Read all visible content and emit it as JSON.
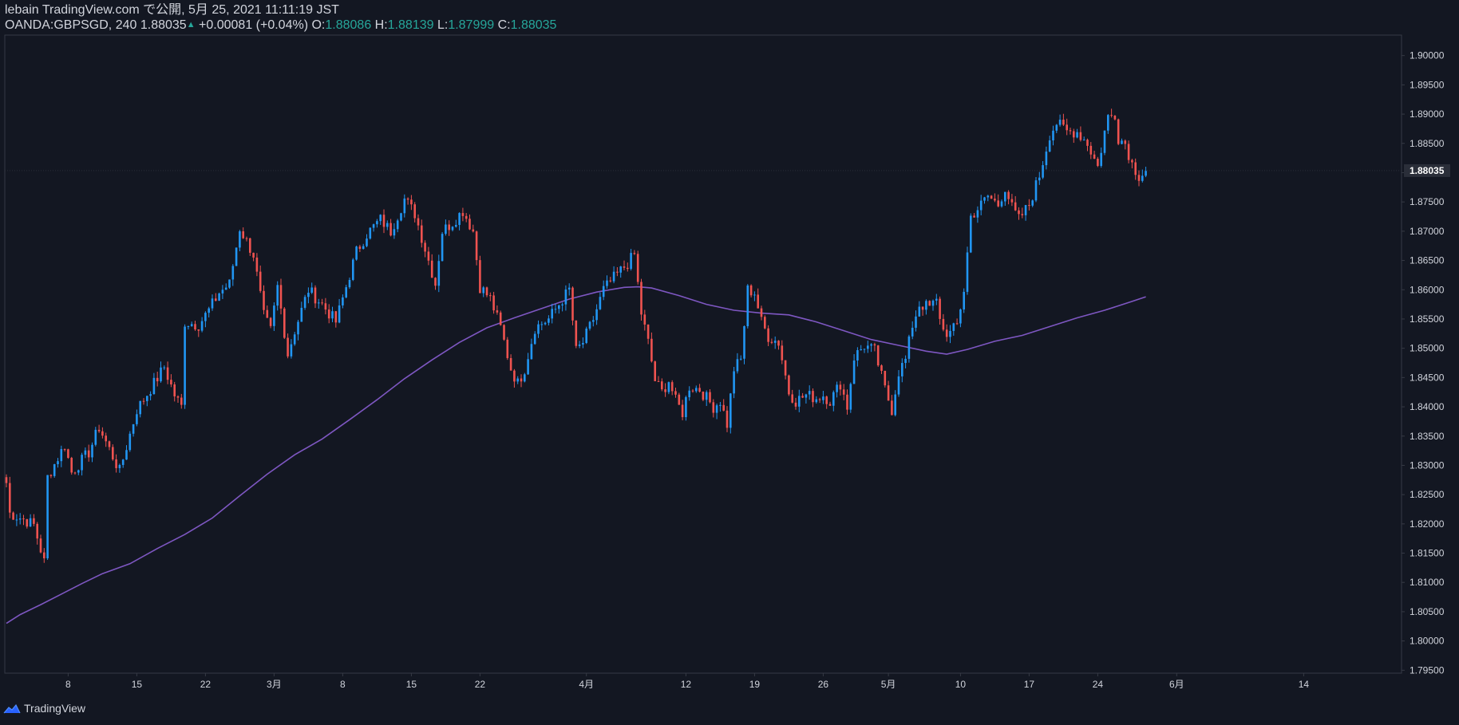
{
  "header": {
    "title_line": "lebain TradingView.com で公開, 5月 25, 2021 11:11:19 JST",
    "symbol": "OANDA:GBPSGD, 240",
    "last": "1.88035",
    "change": "+0.00081 (+0.04%)",
    "o_label": "O:",
    "o_value": "1.88086",
    "h_label": "H:",
    "h_value": "1.88139",
    "l_label": "L:",
    "l_value": "1.87999",
    "c_label": "C:",
    "c_value": "1.88035"
  },
  "footer": {
    "brand": "TradingView",
    "logo_icon": "tradingview-logo-icon"
  },
  "colors": {
    "background": "#131722",
    "up": "#2196f3",
    "down": "#ef5350",
    "ma": "#7e57c2",
    "text": "#d1d4dc",
    "value_green": "#26a69a",
    "axis": "#363a45"
  },
  "chart_data": {
    "type": "candlestick",
    "symbol": "OANDA:GBPSGD",
    "interval": "240",
    "ylim": [
      1.7945,
      1.9035
    ],
    "y_ticks": [
      "1.90000",
      "1.89500",
      "1.89000",
      "1.88500",
      "1.88000",
      "1.87500",
      "1.87000",
      "1.86500",
      "1.86000",
      "1.85500",
      "1.85000",
      "1.84500",
      "1.84000",
      "1.83500",
      "1.83000",
      "1.82500",
      "1.82000",
      "1.81500",
      "1.81000",
      "1.80500",
      "1.80000",
      "1.79500"
    ],
    "last_price_label": "1.88035",
    "x_ticks": [
      {
        "label": "8",
        "index": 18
      },
      {
        "label": "15",
        "index": 38
      },
      {
        "label": "22",
        "index": 58
      },
      {
        "label": "3月",
        "index": 78
      },
      {
        "label": "8",
        "index": 98
      },
      {
        "label": "15",
        "index": 118
      },
      {
        "label": "22",
        "index": 138
      },
      {
        "label": "4月",
        "index": 169
      },
      {
        "label": "12",
        "index": 198
      },
      {
        "label": "19",
        "index": 218
      },
      {
        "label": "26",
        "index": 238
      },
      {
        "label": "5月",
        "index": 257
      },
      {
        "label": "10",
        "index": 278
      },
      {
        "label": "17",
        "index": 298
      },
      {
        "label": "24",
        "index": 318
      },
      {
        "label": "6月",
        "index": 341
      },
      {
        "label": "14",
        "index": 378
      }
    ],
    "anchors": [
      [
        0,
        1.827
      ],
      [
        1,
        1.8218
      ],
      [
        5,
        1.8208
      ],
      [
        8,
        1.8198
      ],
      [
        11,
        1.8135
      ],
      [
        12,
        1.828
      ],
      [
        17,
        1.8335
      ],
      [
        19,
        1.8288
      ],
      [
        24,
        1.8322
      ],
      [
        27,
        1.8365
      ],
      [
        33,
        1.829
      ],
      [
        38,
        1.8395
      ],
      [
        43,
        1.844
      ],
      [
        46,
        1.8468
      ],
      [
        49,
        1.842
      ],
      [
        51,
        1.84
      ],
      [
        52,
        1.8545
      ],
      [
        56,
        1.854
      ],
      [
        59,
        1.8565
      ],
      [
        62,
        1.8595
      ],
      [
        65,
        1.861
      ],
      [
        68,
        1.8705
      ],
      [
        72,
        1.866
      ],
      [
        75,
        1.8555
      ],
      [
        77,
        1.853
      ],
      [
        79,
        1.8605
      ],
      [
        82,
        1.849
      ],
      [
        84,
        1.853
      ],
      [
        88,
        1.86
      ],
      [
        92,
        1.8575
      ],
      [
        96,
        1.8545
      ],
      [
        99,
        1.8605
      ],
      [
        102,
        1.8665
      ],
      [
        105,
        1.8695
      ],
      [
        109,
        1.872
      ],
      [
        112,
        1.87
      ],
      [
        116,
        1.8755
      ],
      [
        119,
        1.873
      ],
      [
        123,
        1.865
      ],
      [
        125,
        1.861
      ],
      [
        127,
        1.87
      ],
      [
        130,
        1.8715
      ],
      [
        133,
        1.8735
      ],
      [
        136,
        1.87
      ],
      [
        138,
        1.8605
      ],
      [
        141,
        1.8585
      ],
      [
        144,
        1.8535
      ],
      [
        147,
        1.8465
      ],
      [
        149,
        1.844
      ],
      [
        151,
        1.8465
      ],
      [
        154,
        1.8535
      ],
      [
        158,
        1.855
      ],
      [
        161,
        1.8575
      ],
      [
        164,
        1.86
      ],
      [
        166,
        1.8495
      ],
      [
        168,
        1.851
      ],
      [
        171,
        1.855
      ],
      [
        174,
        1.86
      ],
      [
        177,
        1.862
      ],
      [
        181,
        1.8645
      ],
      [
        183,
        1.866
      ],
      [
        185,
        1.856
      ],
      [
        187,
        1.851
      ],
      [
        189,
        1.8445
      ],
      [
        191,
        1.8425
      ],
      [
        193,
        1.8445
      ],
      [
        195,
        1.841
      ],
      [
        197,
        1.839
      ],
      [
        199,
        1.8435
      ],
      [
        202,
        1.843
      ],
      [
        204,
        1.8415
      ],
      [
        206,
        1.84
      ],
      [
        208,
        1.841
      ],
      [
        210,
        1.837
      ],
      [
        212,
        1.8465
      ],
      [
        214,
        1.848
      ],
      [
        216,
        1.86
      ],
      [
        218,
        1.8595
      ],
      [
        220,
        1.8545
      ],
      [
        222,
        1.852
      ],
      [
        225,
        1.851
      ],
      [
        228,
        1.8425
      ],
      [
        230,
        1.841
      ],
      [
        233,
        1.842
      ],
      [
        236,
        1.8415
      ],
      [
        238,
        1.842
      ],
      [
        240,
        1.841
      ],
      [
        243,
        1.844
      ],
      [
        245,
        1.84
      ],
      [
        247,
        1.8485
      ],
      [
        250,
        1.8505
      ],
      [
        253,
        1.8495
      ],
      [
        256,
        1.843
      ],
      [
        258,
        1.8395
      ],
      [
        260,
        1.846
      ],
      [
        262,
        1.848
      ],
      [
        264,
        1.854
      ],
      [
        266,
        1.8575
      ],
      [
        269,
        1.857
      ],
      [
        271,
        1.858
      ],
      [
        273,
        1.853
      ],
      [
        275,
        1.8525
      ],
      [
        277,
        1.854
      ],
      [
        279,
        1.86
      ],
      [
        281,
        1.8725
      ],
      [
        284,
        1.8745
      ],
      [
        286,
        1.876
      ],
      [
        289,
        1.8745
      ],
      [
        291,
        1.8775
      ],
      [
        293,
        1.874
      ],
      [
        295,
        1.872
      ],
      [
        298,
        1.8745
      ],
      [
        301,
        1.8795
      ],
      [
        304,
        1.8865
      ],
      [
        306,
        1.8885
      ],
      [
        309,
        1.887
      ],
      [
        312,
        1.887
      ],
      [
        315,
        1.885
      ],
      [
        318,
        1.881
      ],
      [
        320,
        1.887
      ],
      [
        321,
        1.8895
      ],
      [
        323,
        1.89
      ],
      [
        324,
        1.886
      ],
      [
        326,
        1.885
      ],
      [
        328,
        1.8815
      ],
      [
        330,
        1.8795
      ],
      [
        332,
        1.8803
      ]
    ],
    "ma_points": [
      [
        0,
        1.803
      ],
      [
        4,
        1.8045
      ],
      [
        10,
        1.8062
      ],
      [
        16,
        1.808
      ],
      [
        22,
        1.8098
      ],
      [
        28,
        1.8115
      ],
      [
        36,
        1.8132
      ],
      [
        44,
        1.8158
      ],
      [
        52,
        1.8182
      ],
      [
        60,
        1.821
      ],
      [
        68,
        1.8248
      ],
      [
        76,
        1.8285
      ],
      [
        84,
        1.8318
      ],
      [
        92,
        1.8345
      ],
      [
        100,
        1.8378
      ],
      [
        108,
        1.8412
      ],
      [
        116,
        1.8448
      ],
      [
        124,
        1.848
      ],
      [
        132,
        1.851
      ],
      [
        140,
        1.8535
      ],
      [
        148,
        1.8552
      ],
      [
        156,
        1.8568
      ],
      [
        164,
        1.8584
      ],
      [
        172,
        1.8596
      ],
      [
        180,
        1.8604
      ],
      [
        184,
        1.8605
      ],
      [
        188,
        1.8603
      ],
      [
        196,
        1.859
      ],
      [
        204,
        1.8575
      ],
      [
        212,
        1.8565
      ],
      [
        220,
        1.856
      ],
      [
        228,
        1.8557
      ],
      [
        236,
        1.8545
      ],
      [
        244,
        1.853
      ],
      [
        252,
        1.8515
      ],
      [
        260,
        1.8505
      ],
      [
        268,
        1.8495
      ],
      [
        274,
        1.849
      ],
      [
        280,
        1.8498
      ],
      [
        288,
        1.8512
      ],
      [
        296,
        1.8522
      ],
      [
        304,
        1.8537
      ],
      [
        312,
        1.8552
      ],
      [
        320,
        1.8565
      ],
      [
        328,
        1.858
      ],
      [
        332,
        1.8588
      ]
    ]
  }
}
